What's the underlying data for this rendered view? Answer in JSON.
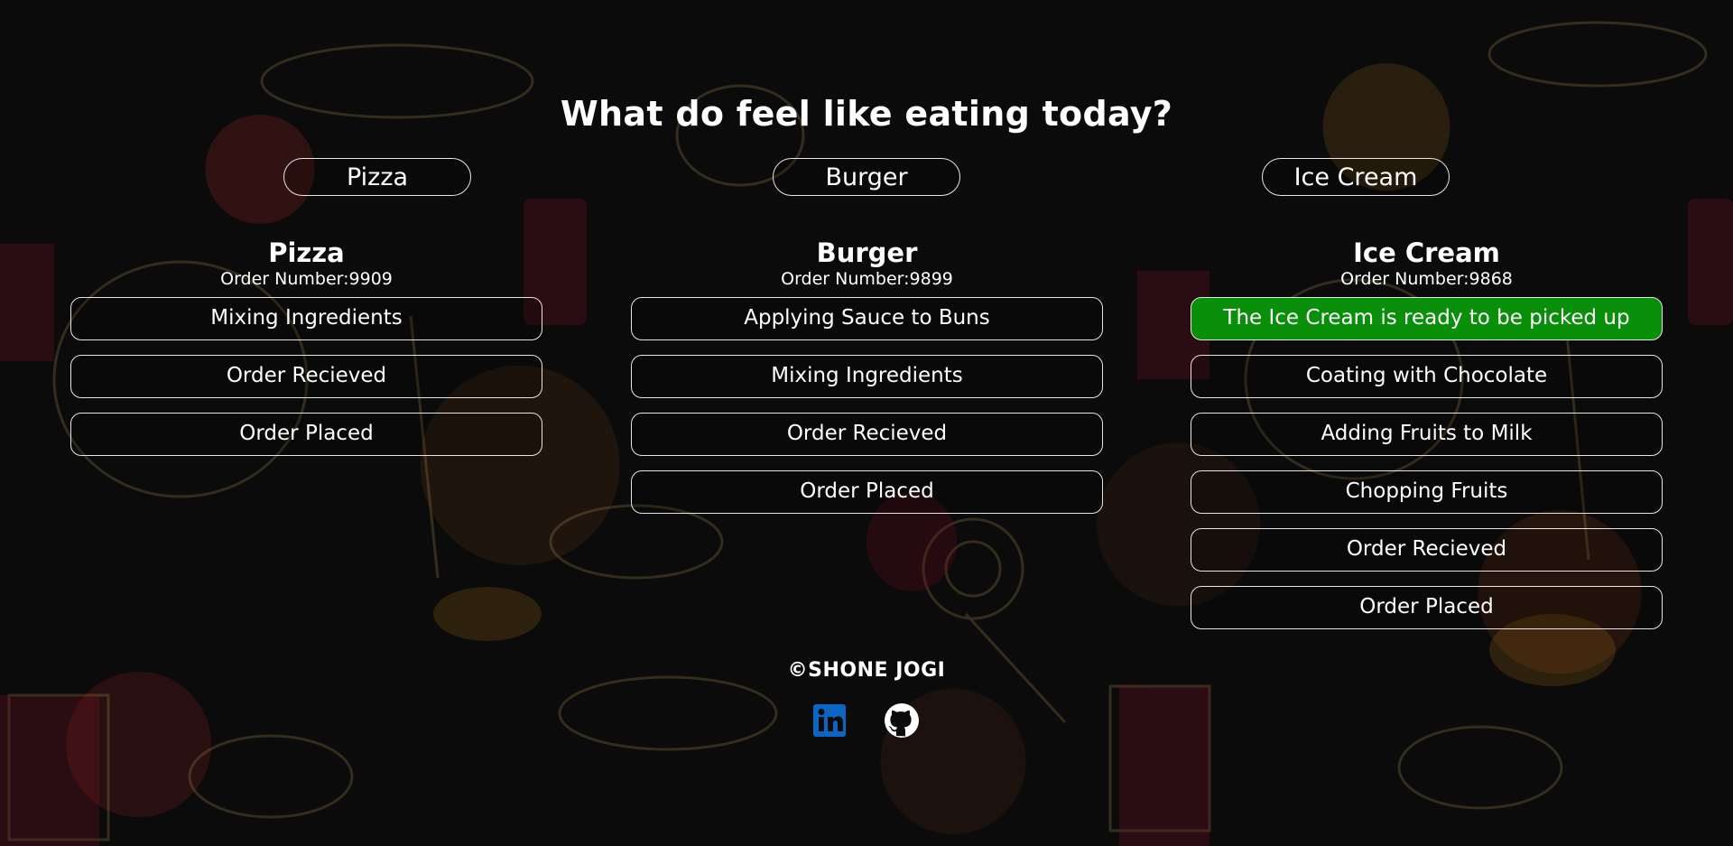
{
  "header": {
    "title": "What do feel like eating today?"
  },
  "menu_buttons": [
    {
      "label": "Pizza"
    },
    {
      "label": "Burger"
    },
    {
      "label": "Ice Cream"
    }
  ],
  "orders": [
    {
      "title": "Pizza",
      "order_number": "Order Number:9909",
      "steps": [
        "Mixing Ingredients",
        "Order Recieved",
        "Order Placed"
      ]
    },
    {
      "title": "Burger",
      "order_number": "Order Number:9899",
      "steps": [
        "Applying Sauce to Buns",
        "Mixing Ingredients",
        "Order Recieved",
        "Order Placed"
      ]
    },
    {
      "title": "Ice Cream",
      "order_number": "Order Number:9868",
      "steps": [
        "The Ice Cream is ready to be picked up",
        "Coating with Chocolate",
        "Adding Fruits to Milk",
        "Chopping Fruits",
        "Order Recieved",
        "Order Placed"
      ]
    }
  ],
  "footer": {
    "brand": "©SHONE JOGI",
    "icons": [
      "linkedin-icon",
      "github-icon"
    ]
  },
  "colors": {
    "ready": "#0a8f0a",
    "linkedin": "#0a66c2",
    "border": "#e6e6e6"
  }
}
